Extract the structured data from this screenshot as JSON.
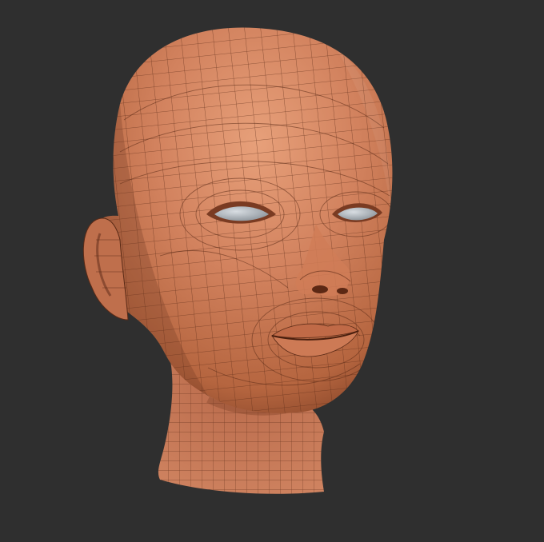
{
  "scene": {
    "subject": "sculpted-head-wireframe",
    "colors": {
      "background": "#2f2f2f",
      "skin_light": "#e0936c",
      "skin_mid": "#c87553",
      "skin_dark": "#8a4a2f",
      "wire": "#5a2a16",
      "eye": "#b9c0c6"
    }
  }
}
